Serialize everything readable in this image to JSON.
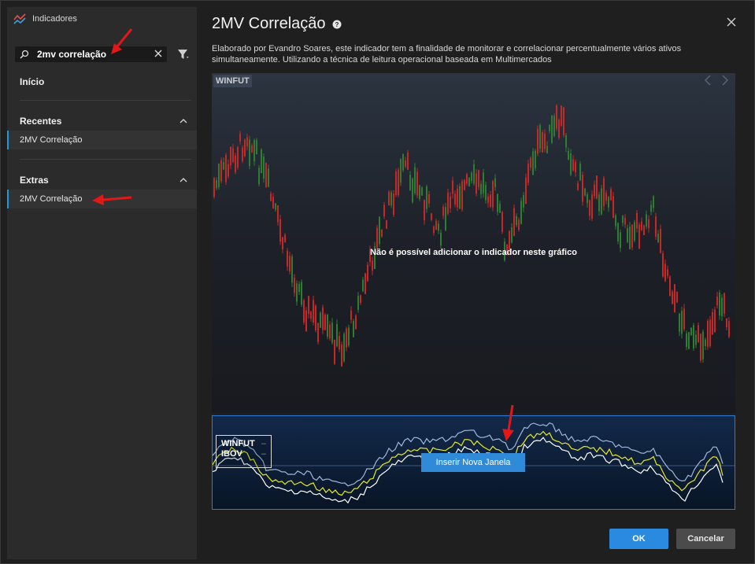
{
  "sidebar": {
    "window_title": "Indicadores",
    "search": {
      "value": "2mv correlação"
    },
    "home_label": "Início",
    "sections": [
      {
        "title": "Recentes",
        "items": [
          {
            "label": "2MV Correlação"
          }
        ]
      },
      {
        "title": "Extras",
        "items": [
          {
            "label": "2MV Correlação"
          }
        ]
      }
    ]
  },
  "main": {
    "title": "2MV Correlação",
    "description": "Elaborado por Evandro Soares, este indicador tem a finalidade de monitorar e correlacionar percentualmente vários ativos simultaneamente. Utilizando a técnica de leitura operacional baseada em Multimercados",
    "preview": {
      "ticker": "WINFUT",
      "message": "Não é possível adicionar o indicador neste gráfico"
    },
    "indicator_panel": {
      "legend": [
        "WINFUT",
        "IBOV"
      ],
      "legend_marker": "–",
      "insert_button": "Inserir Nova Janela"
    }
  },
  "footer": {
    "ok_label": "OK",
    "cancel_label": "Cancelar"
  },
  "colors": {
    "accent": "#2a8ae0",
    "candle_up": "#2e7d32",
    "candle_down": "#c62828",
    "line_yellow": "#e8e82a",
    "line_white": "#ffffff",
    "line_blue": "#9fb8dc",
    "annotation": "#e01818"
  },
  "icons": {
    "app": "chart-lines-icon",
    "search": "magnifier-icon",
    "clear": "close-icon",
    "filter": "funnel-icon",
    "help": "question-circle-icon",
    "close": "close-icon",
    "section_toggle": "chevron-up-icon"
  }
}
